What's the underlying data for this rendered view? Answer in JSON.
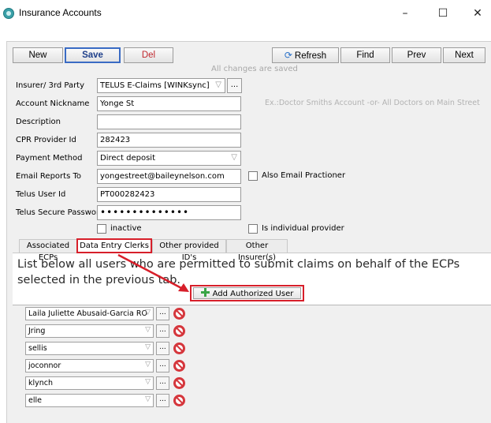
{
  "window": {
    "title": "Insurance Accounts",
    "controls": {
      "minimize": "–",
      "maximize": "☐",
      "close": "✕"
    }
  },
  "toolbar": {
    "new_label": "New",
    "save_label": "Save",
    "del_label": "Del",
    "refresh_label": "Refresh",
    "find_label": "Find",
    "prev_label": "Prev",
    "next_label": "Next",
    "status": "All changes are saved"
  },
  "form": {
    "insurer": {
      "label": "Insurer/ 3rd Party",
      "value": "TELUS E-Claims [WINKsync]",
      "button": "..."
    },
    "nickname": {
      "label": "Account Nickname",
      "value": "Yonge St",
      "hint": "Ex.:Doctor Smiths Account -or- All Doctors on Main Street"
    },
    "description": {
      "label": "Description",
      "value": ""
    },
    "cpr": {
      "label": "CPR Provider Id",
      "value": "282423"
    },
    "payment": {
      "label": "Payment Method",
      "value": "Direct deposit"
    },
    "email": {
      "label": "Email Reports To",
      "value": "yongestreet@baileynelson.com",
      "also_email_label": "Also Email Practioner"
    },
    "telus_user": {
      "label": "Telus User Id",
      "value": "PT000282423"
    },
    "telus_password": {
      "label": "Telus Secure Password",
      "value": "••••••••••••••"
    },
    "inactive_label": "inactive",
    "individual_label": "Is individual provider"
  },
  "tabs": [
    {
      "label": "Associated ECPs"
    },
    {
      "label": "Data Entry Clerks"
    },
    {
      "label": "Other provided ID's"
    },
    {
      "label": "Other Insurer(s)"
    }
  ],
  "panel": {
    "description": "List below all users who are permitted to submit claims on behalf of the ECPs selected in the previous tab.",
    "add_button_label": "Add Authorized User",
    "users": [
      {
        "name": "Laila Juliette Abusaid-Garcia RO"
      },
      {
        "name": "Jring"
      },
      {
        "name": "sellis"
      },
      {
        "name": "joconnor"
      },
      {
        "name": "klynch"
      },
      {
        "name": "elle"
      }
    ],
    "dots_label": "..."
  },
  "icons": {
    "app": "app-logo-icon",
    "refresh": "refresh-icon",
    "add": "plus-icon",
    "remove": "remove-icon",
    "dropdown": "chevron-down-icon"
  },
  "colors": {
    "highlight": "#d71f2a",
    "save_accent": "#3a6bc4",
    "delete_text": "#c0292f",
    "add_icon": "#3aa546"
  }
}
